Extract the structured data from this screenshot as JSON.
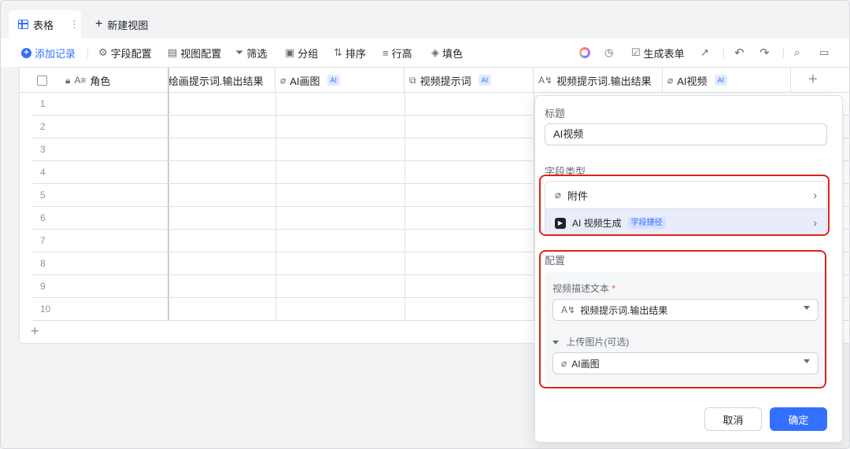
{
  "view_tabs": {
    "active_label": "表格",
    "new_view_label": "新建视图"
  },
  "toolbar": {
    "add_record": "添加记录",
    "field_config": "字段配置",
    "view_config": "视图配置",
    "filter": "筛选",
    "group": "分组",
    "sort": "排序",
    "row_height": "行高",
    "fill_color": "填色",
    "generate_form": "生成表单"
  },
  "table": {
    "columns": [
      {
        "label": "角色",
        "ai": false
      },
      {
        "label": "绘画提示词.输出结果",
        "ai": false
      },
      {
        "label": "AI画图",
        "ai": true
      },
      {
        "label": "视频提示词",
        "ai": true
      },
      {
        "label": "视频提示词.输出结果",
        "ai": false
      },
      {
        "label": "AI视频",
        "ai": true
      }
    ],
    "ai_tag": "AI",
    "rows": [
      "1",
      "2",
      "3",
      "4",
      "5",
      "6",
      "7",
      "8",
      "9",
      "10"
    ]
  },
  "panel": {
    "title_label": "标题",
    "title_value": "AI视频",
    "field_type_label": "字段类型",
    "field_type_attachment": "附件",
    "field_type_ai": "AI 视频生成",
    "field_shortcut_tag": "字段捷径",
    "config_label": "配置",
    "video_desc_label": "视频描述文本",
    "required_mark": "*",
    "video_desc_value": "视频提示词.输出结果",
    "upload_label": "上传图片(可选)",
    "upload_value": "AI画图",
    "cancel_button": "取消",
    "ok_button": "确定"
  },
  "colors": {
    "accent": "#3370ff",
    "highlight_border": "#e2231a"
  }
}
